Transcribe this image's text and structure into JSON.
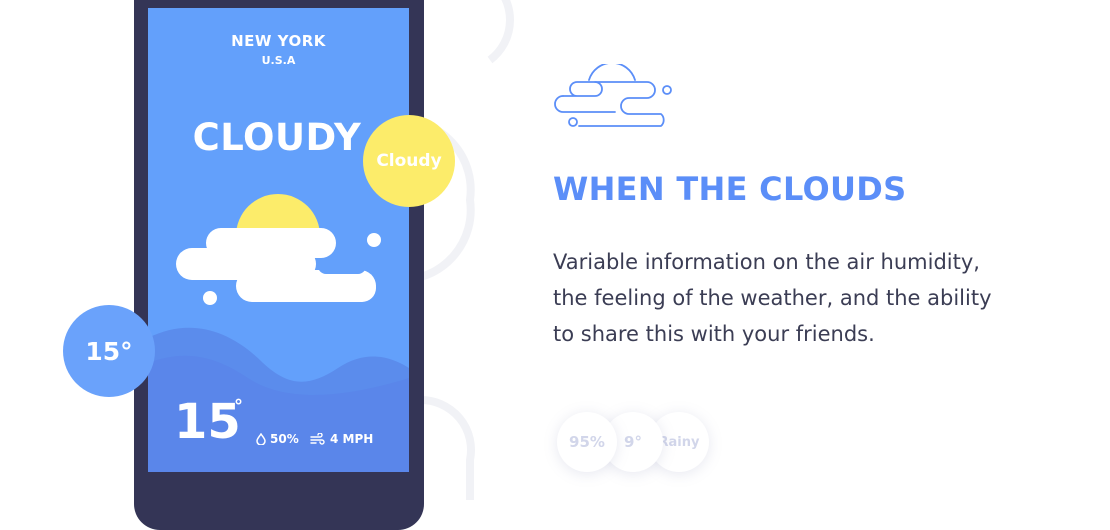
{
  "phone": {
    "city": "NEW YORK",
    "country": "U.S.A",
    "condition": "CLOUDY",
    "temperature": "15",
    "degree_symbol": "°",
    "humidity": "50%",
    "wind": "4 MPH",
    "humidity_icon": "droplet-icon",
    "wind_icon": "wind-icon"
  },
  "badges": {
    "condition_label": "Cloudy",
    "temperature_label": "15°"
  },
  "feature": {
    "icon": "sun-cloud-outline-icon",
    "title": "WHEN THE CLOUDS",
    "description_lines": [
      "Variable information on the air humidity,",
      "the feeling of the weather, and the ability",
      "to share this with your friends."
    ]
  },
  "chips": [
    "95%",
    "9°",
    "Rainy"
  ],
  "colors": {
    "screen_bg": "#63a0fb",
    "phone_frame": "#343556",
    "accent_blue": "#5b8ef8",
    "sun_yellow": "#fcec6a",
    "text_dark": "#3b3d54",
    "chip_text": "#d2d6ea"
  }
}
